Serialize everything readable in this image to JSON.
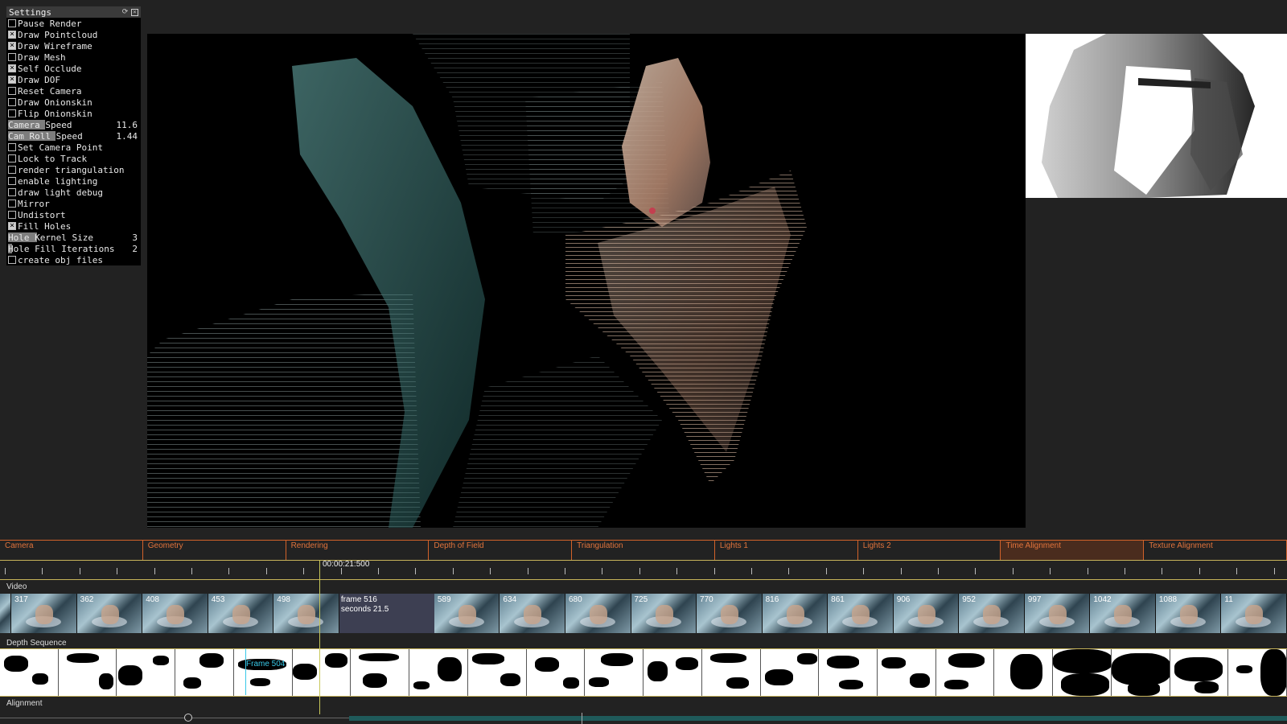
{
  "settings": {
    "title": "Settings",
    "items": [
      {
        "type": "checkbox",
        "label": "Pause Render",
        "checked": false
      },
      {
        "type": "checkbox",
        "label": "Draw Pointcloud",
        "checked": true
      },
      {
        "type": "checkbox",
        "label": "Draw Wireframe",
        "checked": true
      },
      {
        "type": "checkbox",
        "label": "Draw Mesh",
        "checked": false
      },
      {
        "type": "checkbox",
        "label": "Self Occlude",
        "checked": true
      },
      {
        "type": "checkbox",
        "label": "Draw DOF",
        "checked": true
      },
      {
        "type": "checkbox",
        "label": "Reset Camera",
        "checked": false
      },
      {
        "type": "checkbox",
        "label": "Draw Onionskin",
        "checked": false
      },
      {
        "type": "checkbox",
        "label": "Flip Onionskin",
        "checked": false
      },
      {
        "type": "slider",
        "label": "Camera Speed",
        "value": "11.6",
        "level": 0.28
      },
      {
        "type": "slider",
        "label": "Cam Roll Speed",
        "value": "1.44",
        "level": 0.36
      },
      {
        "type": "checkbox",
        "label": "Set Camera Point",
        "checked": false
      },
      {
        "type": "checkbox",
        "label": "Lock to Track",
        "checked": false
      },
      {
        "type": "checkbox",
        "label": "render triangulation",
        "checked": false
      },
      {
        "type": "checkbox",
        "label": "enable lighting",
        "checked": false
      },
      {
        "type": "checkbox",
        "label": "draw light debug",
        "checked": false
      },
      {
        "type": "checkbox",
        "label": "Mirror",
        "checked": false
      },
      {
        "type": "checkbox",
        "label": "Undistort",
        "checked": false
      },
      {
        "type": "checkbox",
        "label": "Fill Holes",
        "checked": true
      },
      {
        "type": "slider",
        "label": "Hole Kernel Size",
        "value": "3",
        "level": 0.22
      },
      {
        "type": "slider",
        "label": "Hole Fill Iterations",
        "value": "2",
        "level": 0.03
      },
      {
        "type": "checkbox",
        "label": "create obj files",
        "checked": false
      }
    ]
  },
  "timeline": {
    "tabs": [
      "Camera",
      "Geometry",
      "Rendering",
      "Depth of Field",
      "Triangulation",
      "Lights 1",
      "Lights 2",
      "Time Alignment",
      "Texture Alignment"
    ],
    "active_tab": "Time Alignment",
    "current_time": "00:00:21:500",
    "tracks": {
      "video": "Video",
      "depth": "Depth Sequence",
      "alignment": "Alignment"
    },
    "video_frames_before": [
      "317",
      "362",
      "408",
      "453",
      "498"
    ],
    "video_frames_after": [
      "589",
      "634",
      "680",
      "725",
      "770",
      "816",
      "861",
      "906",
      "952",
      "997",
      "1042",
      "1088",
      "11"
    ],
    "hover_frame": "frame 516",
    "hover_seconds": "seconds 21.5",
    "depth_hover_label": "Frame 504"
  },
  "colors": {
    "accent": "#e0733c",
    "playhead": "#c7c75a",
    "depth_marker": "#38c8e8"
  }
}
